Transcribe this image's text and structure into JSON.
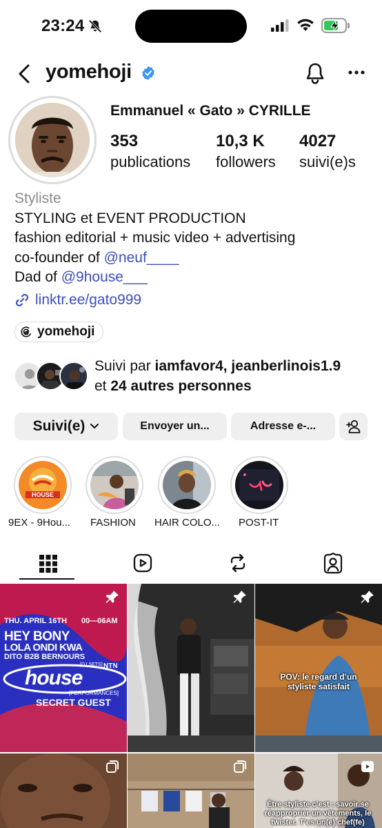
{
  "status_bar": {
    "time": "23:24"
  },
  "header": {
    "username": "yomehoji"
  },
  "profile": {
    "full_name": "Emmanuel « Gato » CYRILLE",
    "stats": [
      {
        "value": "353",
        "label": "publications"
      },
      {
        "value": "10,3 K",
        "label": "followers"
      },
      {
        "value": "4027",
        "label": "suivi(e)s"
      }
    ],
    "category": "Styliste",
    "bio_line1": "STYLING et EVENT PRODUCTION",
    "bio_line2": "fashion editorial + music video + advertising",
    "bio_line3_prefix": "co-founder of ",
    "bio_line3_mention": "@neuf____",
    "bio_line4_prefix": "Dad of ",
    "bio_line4_mention": "@9house___",
    "link": "linktr.ee/gato999",
    "threads_handle": "yomehoji"
  },
  "followed_by": {
    "prefix": "Suivi par ",
    "names": "iamfavor4, jeanberlinois1.9",
    "line2_prefix": "et ",
    "others": "24 autres personnes"
  },
  "buttons": {
    "following": "Suivi(e)",
    "message": "Envoyer un...",
    "email": "Adresse e-..."
  },
  "highlights": [
    {
      "label": "9EX - 9Hou..."
    },
    {
      "label": "FASHION"
    },
    {
      "label": "HAIR COLO..."
    },
    {
      "label": "POST-IT"
    }
  ],
  "posts": {
    "p1": {
      "date": "THU. APRIL 16TH",
      "time": "00—06AM",
      "line1": "HEY BONY",
      "line2": "LOLA ONDI KWA",
      "line3": "DITO B2B BERNOURS",
      "line3b": "NTN",
      "djsets": "[DJ SETS]",
      "logo": "house",
      "performances": "[PERFORMANCES]",
      "guest": "SECRET GUEST"
    },
    "p3_caption": "POV: le regard d’un styliste satisfait",
    "p6_caption": "Être styliste c’est : savoir se réapproprier un vêtements, le twister. T’es un(e) chef(fe)"
  },
  "colors": {
    "link": "#3b4dbf",
    "verified": "#3897f0",
    "button_bg": "#efefef"
  }
}
